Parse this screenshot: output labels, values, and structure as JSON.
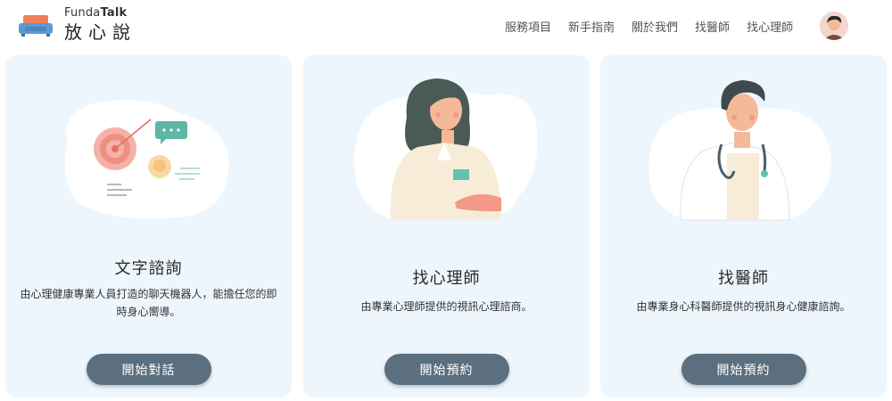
{
  "brand": {
    "en_regular": "Funda",
    "en_bold": "Talk",
    "zh": "放心說"
  },
  "nav": {
    "items": [
      "服務項目",
      "新手指南",
      "關於我們",
      "找醫師",
      "找心理師"
    ]
  },
  "cards": [
    {
      "title": "文字諮詢",
      "desc": "由心理健康專業人員打造的聊天機器人，能擔任您的即時身心嚮導。",
      "button": "開始對話"
    },
    {
      "title": "找心理師",
      "desc": "由專業心理師提供的視訊心理諮商。",
      "button": "開始預約"
    },
    {
      "title": "找醫師",
      "desc": "由專業身心科醫師提供的視訊身心健康諮詢。",
      "button": "開始預約"
    }
  ],
  "colors": {
    "card_bg": "#eef6fd",
    "button_bg": "#5b6f7e",
    "logo_orange": "#ef7f57",
    "logo_blue": "#5a9bd8"
  },
  "icons": [
    "sofa-logo-icon",
    "user-avatar",
    "target-chat-illustration",
    "psychologist-illustration",
    "doctor-illustration"
  ]
}
